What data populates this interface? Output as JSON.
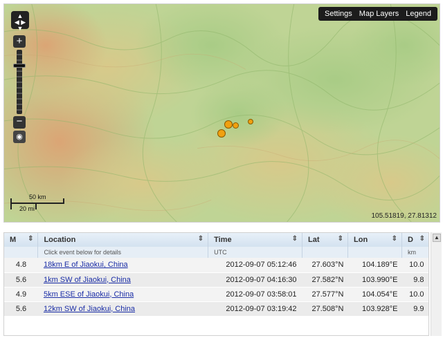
{
  "map": {
    "menu": [
      "Settings",
      "Map Layers",
      "Legend"
    ],
    "zoom_in_label": "+",
    "zoom_out_label": "−",
    "scale": {
      "km_label": "50 km",
      "mi_label": "20 mi"
    },
    "coords": "105.51819, 27.81312",
    "quake_color": "#f0a010",
    "terrain_colors": {
      "low": "#a9cc86",
      "mid": "#d4d08c",
      "high": "#d9a670"
    }
  },
  "table": {
    "headers": {
      "mag": "M",
      "location": "Location",
      "location_sub": "Click event below for details",
      "time": "Time",
      "time_sub": "UTC",
      "lat": "Lat",
      "lon": "Lon",
      "depth": "D",
      "depth_sub": "km"
    },
    "rows": [
      {
        "mag": "4.8",
        "location": "18km E of Jiaokui, China",
        "time": "2012-09-07 05:12:46",
        "lat": "27.603°N",
        "lon": "104.189°E",
        "depth": "10.0"
      },
      {
        "mag": "5.6",
        "location": "1km SW of Jiaokui, China",
        "time": "2012-09-07 04:16:30",
        "lat": "27.582°N",
        "lon": "103.990°E",
        "depth": "9.8"
      },
      {
        "mag": "4.9",
        "location": "5km ESE of Jiaokui, China",
        "time": "2012-09-07 03:58:01",
        "lat": "27.577°N",
        "lon": "104.054°E",
        "depth": "10.0"
      },
      {
        "mag": "5.6",
        "location": "12km SW of Jiaokui, China",
        "time": "2012-09-07 03:19:42",
        "lat": "27.508°N",
        "lon": "103.928°E",
        "depth": "9.9"
      }
    ]
  }
}
